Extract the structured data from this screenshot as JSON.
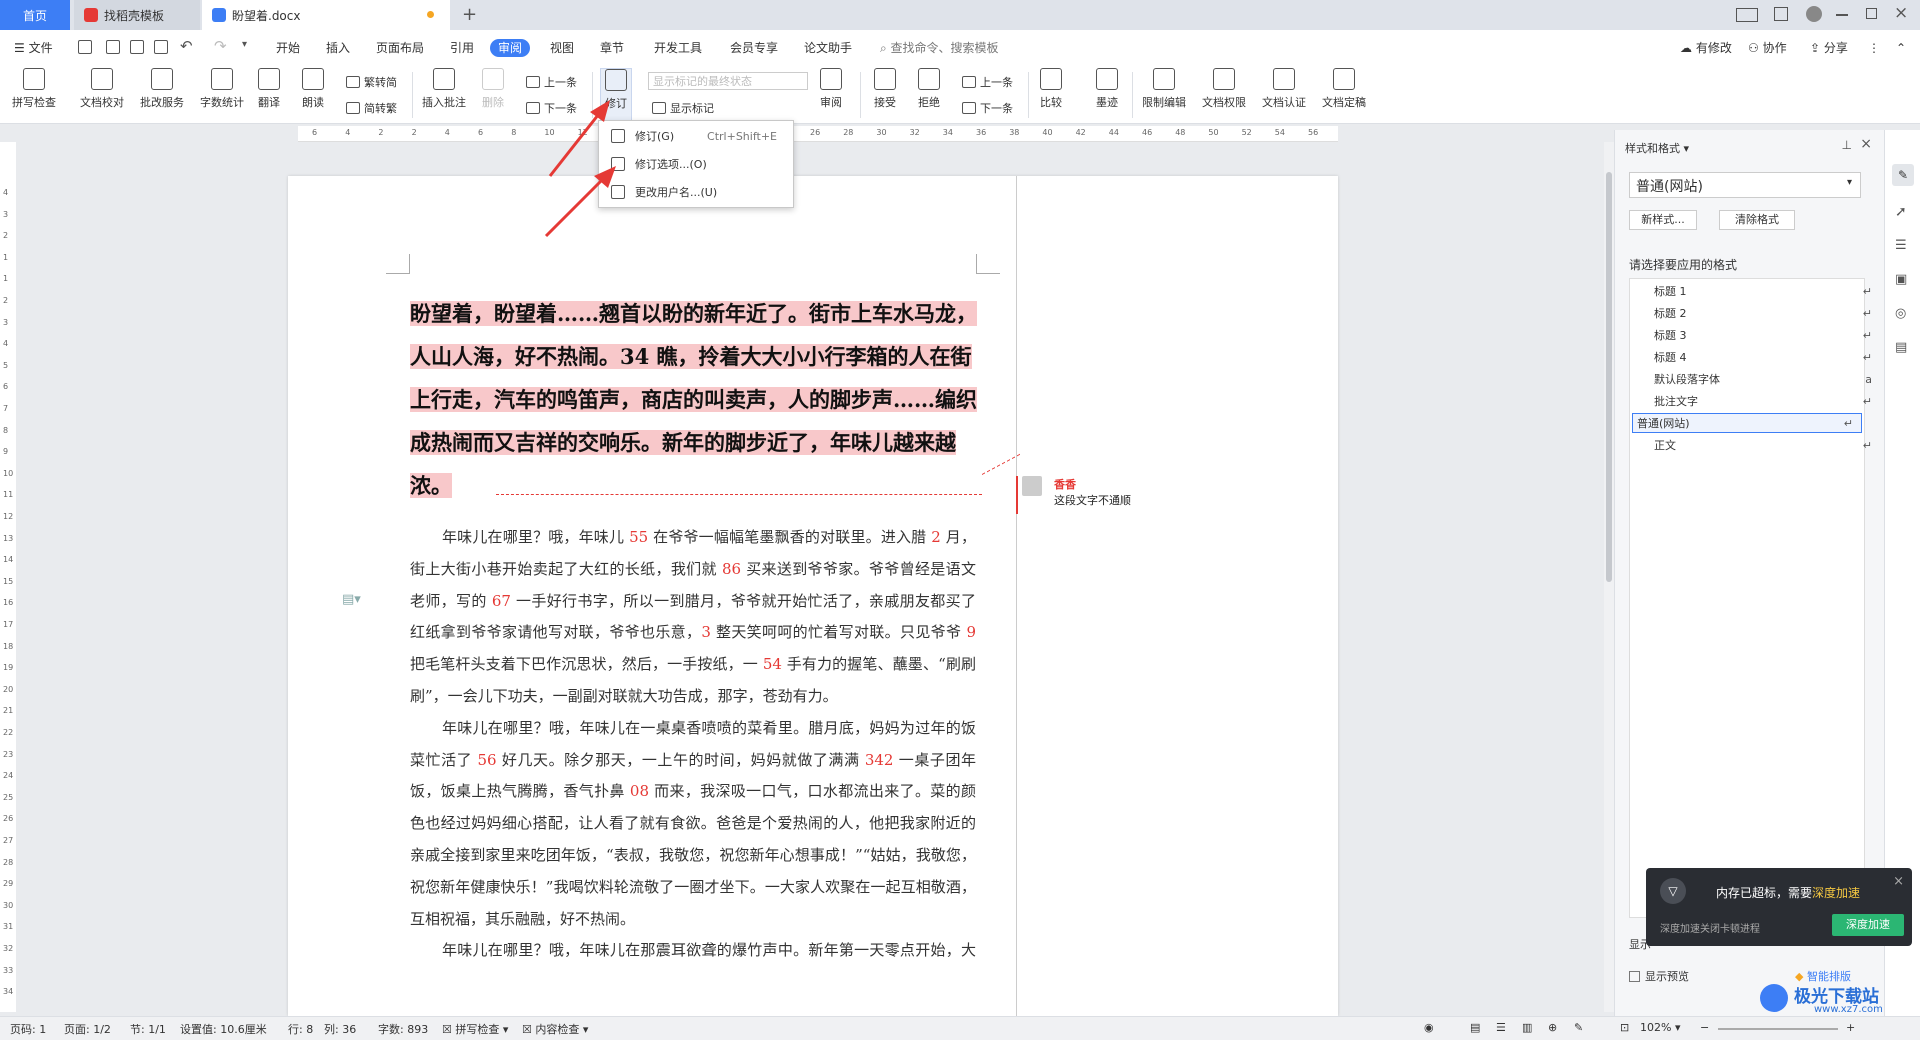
{
  "tabs": {
    "home": "首页",
    "template": "找稻壳模板",
    "doc": "盼望着.docx"
  },
  "menu": {
    "file": "文件",
    "items": [
      "开始",
      "插入",
      "页面布局",
      "引用",
      "审阅",
      "视图",
      "章节",
      "开发工具",
      "会员专享",
      "论文助手"
    ],
    "search": "查找命令、搜索模板",
    "right": {
      "changes": "有修改",
      "collab": "协作",
      "share": "分享"
    }
  },
  "ribbon": {
    "spell": "拼写检查",
    "proof": "文档校对",
    "batch": "批改服务",
    "count": "字数统计",
    "translate": "翻译",
    "read": "朗读",
    "to_trad": "繁转简",
    "to_simp": "简转繁",
    "insert_comment": "插入批注",
    "delete": "删除",
    "prev": "上一条",
    "next": "下一条",
    "revise": "修订",
    "show_state": "显示标记的最终状态",
    "show_marks": "显示标记",
    "review": "审阅",
    "accept": "接受",
    "reject": "拒绝",
    "prev2": "上一条",
    "next2": "下一条",
    "compare": "比较",
    "ink": "墨迹",
    "restrict": "限制编辑",
    "rights": "文档权限",
    "certify": "文档认证",
    "finalize": "文档定稿"
  },
  "dropdown": {
    "item1": "修订(G)",
    "item1_shortcut": "Ctrl+Shift+E",
    "item2": "修订选项...(O)",
    "item3": "更改用户名...(U)"
  },
  "ruler_marks": [
    "6",
    "4",
    "2",
    "2",
    "4",
    "6",
    "8",
    "10",
    "12",
    "14",
    "16",
    "18",
    "20",
    "22",
    "24",
    "26",
    "28",
    "30",
    "32",
    "34",
    "36",
    "38",
    "40",
    "42",
    "44",
    "46",
    "48",
    "50",
    "52",
    "54",
    "56"
  ],
  "vruler_marks": [
    "4",
    "3",
    "2",
    "1",
    "1",
    "2",
    "3",
    "4",
    "5",
    "6",
    "7",
    "8",
    "9",
    "10",
    "11",
    "12",
    "13",
    "14",
    "15",
    "16",
    "17",
    "18",
    "19",
    "20",
    "21",
    "22",
    "23",
    "24",
    "25",
    "26",
    "27",
    "28",
    "29",
    "30",
    "31",
    "32",
    "33",
    "34"
  ],
  "document": {
    "heading": "盼望着，盼望着……翘首以盼的新年近了。街市上车水马龙，人山人海，好不热闹。34 瞧，拎着大大小小行李箱的人在街上行走，汽车的鸣笛声，商店的叫卖声，人的脚步声……编织成热闹而又吉祥的交响乐。新年的脚步近了，年味儿越来越浓。",
    "p1": [
      {
        "t": "年味儿在哪里？哦，年味儿 "
      },
      {
        "t": "55",
        "r": true
      },
      {
        "t": " 在爷爷一幅幅笔墨飘香的对联里。进入腊 "
      },
      {
        "t": "2",
        "r": true
      },
      {
        "t": " 月，街上大街小巷开始卖起了大红的长纸，我们就 "
      },
      {
        "t": "86",
        "r": true
      },
      {
        "t": " 买来送到爷爷家。爷爷曾经是语文老师，写的 "
      },
      {
        "t": "67",
        "r": true
      },
      {
        "t": " 一手好行书字，所以一到腊月，爷爷就开始忙活了，亲戚朋友都买了红纸拿到爷爷家请他写对联，爷爷也乐意，"
      },
      {
        "t": "3",
        "r": true
      },
      {
        "t": " 整天笑呵呵的忙着写对联。只见爷爷 "
      },
      {
        "t": "9",
        "r": true
      },
      {
        "t": " 把毛笔杆头支着下巴作沉思状，然后，一手按纸，一 "
      },
      {
        "t": "54",
        "r": true
      },
      {
        "t": " 手有力的握笔、蘸墨、“刷刷刷”，一会儿下功夫，一副副对联就大功告成，那字，苍劲有力。"
      }
    ],
    "p2": [
      {
        "t": "年味儿在哪里？哦，年味儿在一桌桌香喷喷的菜肴里。腊月底，妈妈为过年的饭菜忙活了 "
      },
      {
        "t": "56",
        "r": true
      },
      {
        "t": " 好几天。除夕那天，一上午的时间，妈妈就做了满满 "
      },
      {
        "t": "342",
        "r": true
      },
      {
        "t": " 一桌子团年饭，饭桌上热气腾腾，香气扑鼻 "
      },
      {
        "t": "08",
        "r": true
      },
      {
        "t": " 而来，我深吸一口气，口水都流出来了。菜的颜色也经过妈妈细心搭配，让人看了就有食欲。爸爸是个爱热闹的人，他把我家附近的亲戚全接到家里来吃团年饭，“表叔，我敬您，祝您新年心想事成！”“姑姑，我敬您，祝您新年健康快乐！”我喝饮料轮流敬了一圈才坐下。一大家人欢聚在一起互相敬酒，互相祝福，其乐融融，好不热闹。"
      }
    ],
    "p3": "年味儿在哪里？哦，年味儿在那震耳欲聋的爆竹声中。新年第一天零点开始，大街便迎了喧嚣，家家户户老老少少都开起了高兴爆竹，我们那里的“出天星”"
  },
  "comment": {
    "author": "香香",
    "text": "这段文字不通顺"
  },
  "side_panel": {
    "title": "样式和格式",
    "current_style": "普通(网站)",
    "new_style": "新样式...",
    "clear_format": "清除格式",
    "prompt": "请选择要应用的格式",
    "styles": [
      "标题 1",
      "标题 2",
      "标题 3",
      "标题 4",
      "默认段落字体",
      "批注文字",
      "普通(网站)",
      "正文"
    ],
    "show_label": "显示",
    "preview": "显示预览",
    "smart": "智能排版"
  },
  "toast": {
    "title": "内存已超标，需要",
    "accent": "深度加速",
    "sub": "深度加速关闭卡顿进程",
    "button": "深度加速"
  },
  "status": {
    "page": "页码: 1",
    "pages": "页面: 1/2",
    "section": "节: 1/1",
    "setting": "设置值: 10.6厘米",
    "row": "行: 8",
    "col": "列: 36",
    "words": "字数: 893",
    "spell": "拼写检查",
    "content": "内容检查",
    "zoom": "102%"
  },
  "watermark": {
    "text": "极光下载站",
    "url": "www.xz7.com"
  },
  "colors": {
    "accent": "#3d7ef5",
    "revision_bg": "#f8c8ca",
    "red": "#e53935",
    "arrow": "#e53935"
  }
}
